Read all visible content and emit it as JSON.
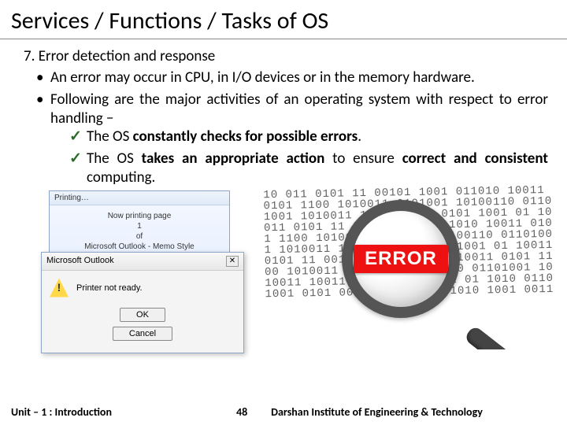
{
  "title": "Services / Functions / Tasks of OS",
  "item_number": "7.",
  "item_heading": "Error detection and response",
  "bullets": {
    "b1": "An error may occur in CPU, in I/O devices or in the memory hardware.",
    "b2": "Following are the major activities of an operating system with respect to error handling −"
  },
  "checks": {
    "c1_pre": "The OS ",
    "c1_bold": "constantly checks for possible errors",
    "c1_post": ".",
    "c2_pre": "The OS ",
    "c2_bold": "takes an appropriate action",
    "c2_mid": " to ensure ",
    "c2_bold2": "correct and consistent",
    "c2_post": " computing."
  },
  "printdlg": {
    "title": "Printing…",
    "line1": "Now printing page",
    "line2": "1",
    "line3": "of",
    "line4": "Microsoft Outlook - Memo Style"
  },
  "msoutlook": {
    "title": "Microsoft Outlook",
    "close": "✕",
    "msg": "Printer not ready.",
    "ok": "OK",
    "cancel": "Cancel"
  },
  "error_label": "ERROR",
  "footer": {
    "unit": "Unit – 1 : Introduction",
    "page": "48",
    "inst": "Darshan Institute of Engineering & Technology"
  }
}
